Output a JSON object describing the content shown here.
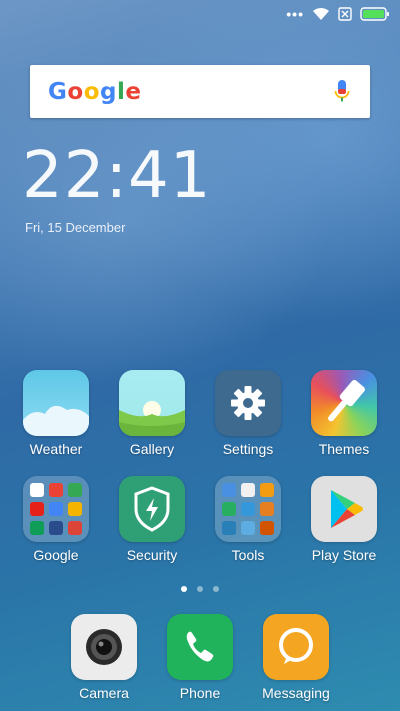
{
  "status_bar": {
    "icons": [
      "more-dots-icon",
      "wifi-icon",
      "sim-none-icon",
      "battery-icon"
    ],
    "dots": "•••"
  },
  "search": {
    "logo": "Google",
    "icons": [
      "google-logo",
      "microphone-icon"
    ]
  },
  "clock": {
    "time": "22:41",
    "date": "Fri, 15 December"
  },
  "apps_row1": [
    {
      "label": "Weather",
      "icon": "weather-icon"
    },
    {
      "label": "Gallery",
      "icon": "gallery-icon"
    },
    {
      "label": "Settings",
      "icon": "gear-icon"
    },
    {
      "label": "Themes",
      "icon": "paintbrush-icon"
    }
  ],
  "apps_row2": [
    {
      "label": "Google",
      "icon": "folder-icon"
    },
    {
      "label": "Security",
      "icon": "shield-icon"
    },
    {
      "label": "Tools",
      "icon": "folder-icon"
    },
    {
      "label": "Play Store",
      "icon": "play-store-icon"
    }
  ],
  "page_indicator": {
    "count": 3,
    "active": 1
  },
  "dock": [
    {
      "label": "Camera",
      "icon": "camera-icon"
    },
    {
      "label": "Phone",
      "icon": "phone-icon"
    },
    {
      "label": "Messaging",
      "icon": "message-icon"
    }
  ],
  "colors": {
    "settings": "#3e6a8f",
    "security": "#2f9f76",
    "phone": "#21b35c",
    "messaging": "#f4a623",
    "play_bg": "#e0e0e0"
  }
}
